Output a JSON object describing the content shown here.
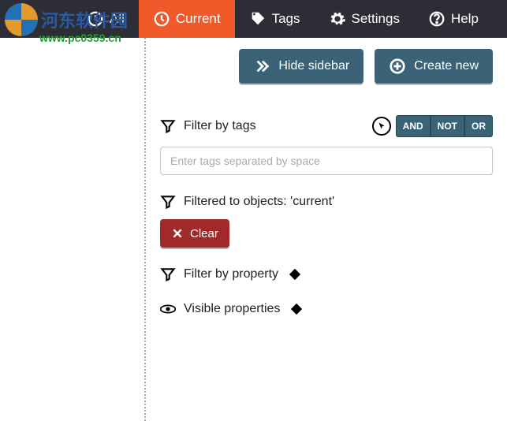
{
  "watermark": {
    "text": "河东软件园",
    "url": "www.pc0359.cn"
  },
  "nav": {
    "all": "All",
    "current": "Current",
    "tags": "Tags",
    "settings": "Settings",
    "help": "Help"
  },
  "actions": {
    "hide_sidebar": "Hide sidebar",
    "create_new": "Create new"
  },
  "filter": {
    "by_tags_label": "Filter by tags",
    "and": "AND",
    "not": "NOT",
    "or": "OR",
    "input_placeholder": "Enter tags separated by space"
  },
  "filtered": {
    "text": "Filtered to objects: 'current'",
    "clear": "Clear"
  },
  "filter_property": "Filter by property",
  "visible_props": "Visible properties"
}
